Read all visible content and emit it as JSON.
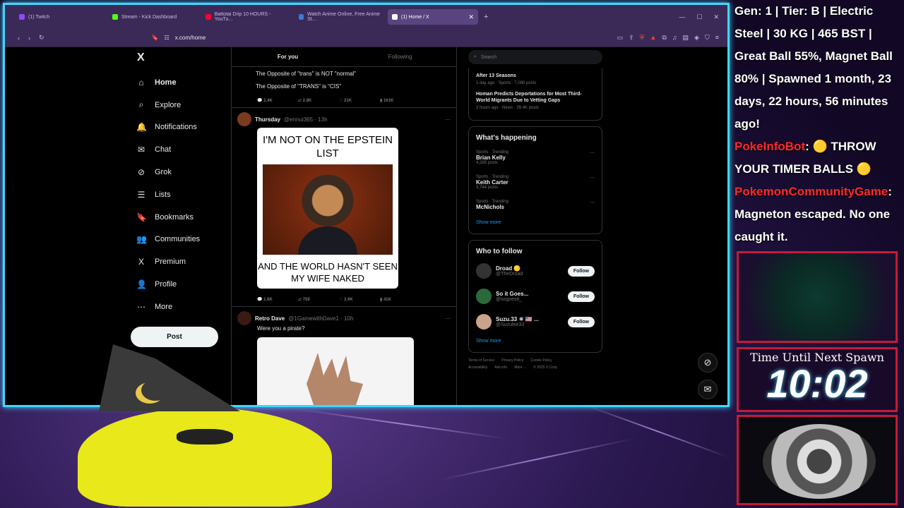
{
  "browser": {
    "tabs": [
      {
        "label": "(1) Twitch",
        "color": "#9147ff",
        "active": false
      },
      {
        "label": "Stream - Kick Dashboard",
        "color": "#53fc18",
        "active": false
      },
      {
        "label": "Battotai Drip 10 HOURS - YouTu...",
        "color": "#ff0033",
        "active": false
      },
      {
        "label": "Watch Anime Online, Free Anime St...",
        "color": "#3a7bd5",
        "active": false
      },
      {
        "label": "(1) Home / X",
        "color": "#ffffff",
        "active": true
      }
    ],
    "url": "x.com/home"
  },
  "x": {
    "logo": "X",
    "nav": [
      {
        "label": "Home",
        "icon": "home-icon",
        "glyph": "⌂"
      },
      {
        "label": "Explore",
        "icon": "search-icon",
        "glyph": "⌕"
      },
      {
        "label": "Notifications",
        "icon": "bell-icon",
        "glyph": "🔔"
      },
      {
        "label": "Chat",
        "icon": "mail-icon",
        "glyph": "✉"
      },
      {
        "label": "Grok",
        "icon": "grok-icon",
        "glyph": "⊘"
      },
      {
        "label": "Lists",
        "icon": "list-icon",
        "glyph": "☰"
      },
      {
        "label": "Bookmarks",
        "icon": "bookmark-icon",
        "glyph": "🔖"
      },
      {
        "label": "Communities",
        "icon": "people-icon",
        "glyph": "👥"
      },
      {
        "label": "Premium",
        "icon": "x-icon",
        "glyph": "X"
      },
      {
        "label": "Profile",
        "icon": "person-icon",
        "glyph": "👤"
      },
      {
        "label": "More",
        "icon": "more-icon",
        "glyph": "⋯"
      }
    ],
    "post_label": "Post",
    "feed_tabs": [
      "For you",
      "Following"
    ],
    "tweet1": {
      "line1": "The Opposite of \"trans\" is NOT \"normal\"",
      "line2": "The Opposite of \"TRANS\" is \"CIS\"",
      "replies": "1.4K",
      "reposts": "2.8K",
      "likes": "21K",
      "views": "161K"
    },
    "tweet2": {
      "name": "Thursday",
      "handle": "@ennui365 · 13h",
      "meme_top": "I'M NOT ON THE EPSTEIN LIST",
      "meme_bottom": "AND THE WORLD HASN'T SEEN MY WIFE NAKED",
      "replies": "1.6K",
      "reposts": "759",
      "likes": "3.9K",
      "views": "41K"
    },
    "tweet3": {
      "name": "Retro Dave",
      "handle": "@1GamewithDave1 · 10h",
      "text": "Were you a pirate?"
    },
    "search_placeholder": "Search",
    "news": [
      {
        "title": "After 13 Seasons",
        "meta": "1 day ago · Sports · 7,080 posts"
      },
      {
        "title": "Homan Predicts Deportations for Most Third-World Migrants Due to Vetting Gaps",
        "meta": "3 hours ago · News · 39.4K posts"
      }
    ],
    "happening_title": "What's happening",
    "trends": [
      {
        "cat": "Sports · Trending",
        "name": "Brian Kelly",
        "count": "4,285 posts"
      },
      {
        "cat": "Sports · Trending",
        "name": "Keith Carter",
        "count": "3,744 posts"
      },
      {
        "cat": "Sports · Trending",
        "name": "McNichols",
        "count": ""
      }
    ],
    "show_more": "Show more",
    "follow_title": "Who to follow",
    "follow": [
      {
        "name": "Droad 🟡",
        "handle": "@TheDroad"
      },
      {
        "name": "So it Goes...",
        "handle": "@sogoesit_"
      },
      {
        "name": "Suzu.33 ☀ 🇺🇸 ...",
        "handle": "@Suzulee33"
      }
    ],
    "follow_label": "Follow",
    "footer": [
      "Terms of Service",
      "Privacy Policy",
      "Cookie Policy",
      "Accessibility",
      "Ads info",
      "More ...",
      "© 2025 X Corp."
    ]
  },
  "stream": {
    "chat_lines": [
      "Gen: 1 | Tier: B | Electric Steel | 30 KG | 465 BST | Great Ball 55%, Magnet Ball 80% | Spawned 1 month, 23 days, 22 hours, 56 minutes ago!",
      "PokeInfoBot",
      ": 🟡 THROW YOUR TIMER BALLS 🟡",
      "PokemonCommunityGame",
      ": Magneton escaped. No one caught it."
    ],
    "timer_label": "Time Until Next Spawn",
    "timer": "10:02"
  }
}
